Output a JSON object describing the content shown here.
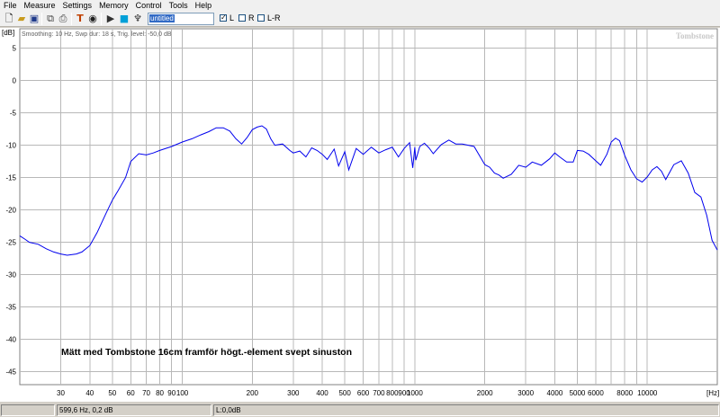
{
  "menu": [
    "File",
    "Measure",
    "Settings",
    "Memory",
    "Control",
    "Tools",
    "Help"
  ],
  "toolbar": {
    "icons": [
      "new-file-icon",
      "open-folder-icon",
      "save-icon",
      "copy-icon",
      "print-icon",
      "hammer-icon",
      "record-icon",
      "play-icon",
      "signal-generator-icon",
      "mic-icon"
    ],
    "name_value": "untitled",
    "channels": [
      {
        "label": "L",
        "checked": true
      },
      {
        "label": "R",
        "checked": false
      },
      {
        "label": "L-R",
        "checked": false
      }
    ]
  },
  "plot": {
    "info": "Smoothing: 10 Hz, Swp dur: 18 s, Trig. level: -50,0 dB",
    "watermark": "Tombstone",
    "annotation": "Mätt med Tombstone 16cm framför högt.-element svept sinuston",
    "colors": {
      "curve": "#0000ee",
      "grid": "#b8b8b8",
      "axis_text": "#000000"
    }
  },
  "status": {
    "cursor": "599,6 Hz, 0,2 dB",
    "level": "L:0,0dB"
  },
  "chart_data": {
    "type": "line",
    "title": "",
    "xlabel": "",
    "ylabel": "",
    "x_scale": "log",
    "x_unit_label": "[Hz]",
    "y_unit_label": "[dB]",
    "xlim": [
      20,
      20000
    ],
    "ylim": [
      -47,
      8
    ],
    "x_ticks": [
      {
        "v": 30,
        "label": "30"
      },
      {
        "v": 40,
        "label": "40"
      },
      {
        "v": 50,
        "label": "50"
      },
      {
        "v": 60,
        "label": "60"
      },
      {
        "v": 70,
        "label": "70"
      },
      {
        "v": 80,
        "label": "80"
      },
      {
        "v": 90,
        "label": "90"
      },
      {
        "v": 100,
        "label": "100"
      },
      {
        "v": 200,
        "label": "200"
      },
      {
        "v": 300,
        "label": "300"
      },
      {
        "v": 400,
        "label": "400"
      },
      {
        "v": 500,
        "label": "500"
      },
      {
        "v": 600,
        "label": "600"
      },
      {
        "v": 700,
        "label": "700"
      },
      {
        "v": 800,
        "label": "800"
      },
      {
        "v": 900,
        "label": "900"
      },
      {
        "v": 1000,
        "label": "1000"
      },
      {
        "v": 2000,
        "label": "2000"
      },
      {
        "v": 3000,
        "label": "3000"
      },
      {
        "v": 4000,
        "label": "4000"
      },
      {
        "v": 5000,
        "label": "5000"
      },
      {
        "v": 6000,
        "label": "6000"
      },
      {
        "v": 8000,
        "label": "8000"
      },
      {
        "v": 10000,
        "label": "10000"
      }
    ],
    "x_minor_grid": [
      7000,
      9000
    ],
    "y_ticks": [
      {
        "v": 5,
        "label": "5"
      },
      {
        "v": 0,
        "label": "0"
      },
      {
        "v": -5,
        "label": "-5"
      },
      {
        "v": -10,
        "label": "-10"
      },
      {
        "v": -15,
        "label": "-15"
      },
      {
        "v": -20,
        "label": "-20"
      },
      {
        "v": -25,
        "label": "-25"
      },
      {
        "v": -30,
        "label": "-30"
      },
      {
        "v": -35,
        "label": "-35"
      },
      {
        "v": -40,
        "label": "-40"
      },
      {
        "v": -45,
        "label": "-45"
      }
    ],
    "grid": true,
    "series": [
      {
        "x": [
          20,
          21,
          22,
          24,
          26,
          28,
          30,
          32,
          35,
          37,
          40,
          43,
          47,
          50,
          53,
          57,
          60,
          65,
          70,
          75,
          80,
          90,
          100,
          110,
          120,
          130,
          140,
          150,
          160,
          170,
          180,
          190,
          200,
          210,
          220,
          230,
          240,
          250,
          270,
          290,
          300,
          320,
          340,
          360,
          380,
          400,
          420,
          450,
          470,
          500,
          520,
          540,
          560,
          600,
          650,
          700,
          750,
          800,
          850,
          900,
          950,
          980,
          1000,
          1010,
          1050,
          1100,
          1150,
          1200,
          1300,
          1400,
          1500,
          1600,
          1800,
          2000,
          2100,
          2200,
          2300,
          2400,
          2600,
          2800,
          3000,
          3200,
          3500,
          3800,
          4000,
          4200,
          4500,
          4800,
          5000,
          5300,
          5600,
          6000,
          6300,
          6700,
          7000,
          7300,
          7600,
          8000,
          8500,
          9000,
          9500,
          10000,
          10500,
          11000,
          11500,
          12000,
          13000,
          14000,
          15000,
          16000,
          17000,
          18000,
          19000,
          20000
        ],
        "y": [
          -24,
          -24.5,
          -25,
          -25.3,
          -26,
          -26.5,
          -26.8,
          -27,
          -26.8,
          -26.5,
          -25.5,
          -23.5,
          -20.5,
          -18.5,
          -17,
          -15,
          -12.5,
          -11.3,
          -11.5,
          -11.2,
          -10.8,
          -10.2,
          -9.5,
          -9,
          -8.4,
          -7.9,
          -7.3,
          -7.3,
          -7.8,
          -9,
          -9.8,
          -8.8,
          -7.6,
          -7.2,
          -7,
          -7.5,
          -9,
          -10,
          -9.8,
          -10.8,
          -11.2,
          -10.9,
          -11.8,
          -10.4,
          -10.8,
          -11.4,
          -12.2,
          -10.6,
          -13.2,
          -11,
          -13.8,
          -12.1,
          -10.5,
          -11.4,
          -10.3,
          -11.2,
          -10.7,
          -10.3,
          -11.8,
          -10.5,
          -9.6,
          -13.5,
          -10.3,
          -12.3,
          -10.2,
          -9.7,
          -10.4,
          -11.3,
          -9.9,
          -9.2,
          -9.8,
          -9.8,
          -10.2,
          -13,
          -13.4,
          -14.3,
          -14.6,
          -15.1,
          -14.5,
          -13.1,
          -13.4,
          -12.6,
          -13.1,
          -12.1,
          -11.2,
          -11.8,
          -12.6,
          -12.6,
          -10.8,
          -10.9,
          -11.4,
          -12.4,
          -13.1,
          -11.4,
          -9.5,
          -8.9,
          -9.3,
          -11.6,
          -13.8,
          -15.2,
          -15.7,
          -14.9,
          -13.8,
          -13.3,
          -14,
          -15.3,
          -13,
          -12.4,
          -14.3,
          -17.3,
          -18,
          -20.8,
          -24.7,
          -26.2
        ]
      }
    ]
  }
}
